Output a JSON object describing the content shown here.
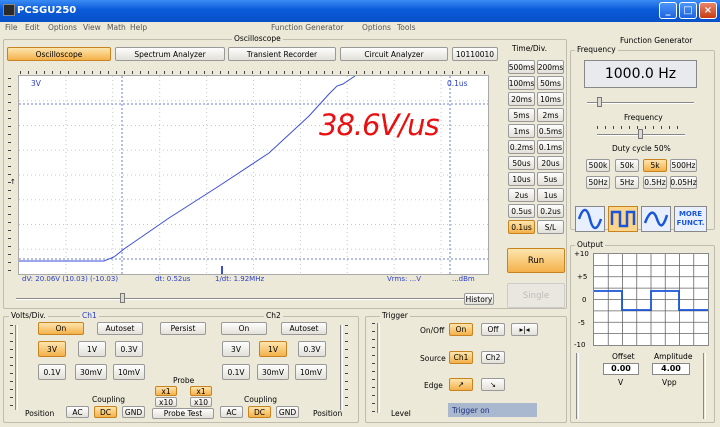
{
  "window": {
    "title": "PCSGU250",
    "minimize": "_",
    "maximize": "□",
    "close": "×"
  },
  "menu": {
    "left": [
      "File",
      "Edit",
      "Options",
      "View",
      "Math",
      "Help"
    ],
    "right_title": "Function Generator",
    "right": [
      "Options",
      "Tools"
    ]
  },
  "osc": {
    "group_label": "Oscilloscope",
    "tabs": [
      "Oscilloscope",
      "Spectrum Analyzer",
      "Transient Recorder",
      "Circuit Analyzer",
      "10110010"
    ],
    "scope": {
      "top_left": "3V",
      "top_right": "0.1us",
      "annotation": "38.6V/us",
      "readouts": {
        "dv": "dV: 20.06V  (10.03)  (-10.03)",
        "dt": "dt: 0.52us",
        "freq": "1/dt: 1.92MHz",
        "vrms": "Vrms: ...V",
        "dbm": "...dBm"
      }
    },
    "history": "History",
    "timediv": {
      "label": "Time/Div.",
      "rows": [
        [
          "500ms",
          "200ms"
        ],
        [
          "100ms",
          "50ms"
        ],
        [
          "20ms",
          "10ms"
        ],
        [
          "5ms",
          "2ms"
        ],
        [
          "1ms",
          "0.5ms"
        ],
        [
          "0.2ms",
          "0.1ms"
        ],
        [
          "50us",
          "20us"
        ],
        [
          "10us",
          "5us"
        ],
        [
          "2us",
          "1us"
        ],
        [
          "0.5us",
          "0.2us"
        ],
        [
          "0.1us",
          "S/L"
        ]
      ],
      "selected": "0.1us"
    },
    "run": "Run",
    "single": "Single"
  },
  "volts": {
    "label": "Volts/Div.",
    "ch1": "Ch1",
    "ch2": "Ch2",
    "ch1_on": "On",
    "ch1_autoset": "Autoset",
    "persist": "Persist",
    "ch2_on": "On",
    "ch2_autoset": "Autoset",
    "ch1_row1": [
      "3V",
      "1V",
      "0.3V"
    ],
    "ch1_row2": [
      "0.1V",
      "30mV",
      "10mV"
    ],
    "ch2_row1": [
      "3V",
      "1V",
      "0.3V"
    ],
    "ch2_row2": [
      "0.1V",
      "30mV",
      "10mV"
    ],
    "ch1_selected": "3V",
    "ch2_selected": "1V",
    "probe_label": "Probe",
    "probe_r1": [
      "x1",
      "x1"
    ],
    "probe_r2": [
      "x10",
      "x10"
    ],
    "probe_test": "Probe Test",
    "coupling": "Coupling",
    "coupling_opts": [
      "AC",
      "DC",
      "GND"
    ],
    "coupling_selected": "DC",
    "position": "Position"
  },
  "trigger": {
    "label": "Trigger",
    "onoff": "On/Off",
    "on": "On",
    "off": "Off",
    "source": "Source",
    "src": [
      "Ch1",
      "Ch2"
    ],
    "edge": "Edge",
    "level": "Level",
    "status": "Trigger on"
  },
  "fg": {
    "title": "Function Generator",
    "freq_label": "Frequency",
    "display": "1000.0 Hz",
    "frequency": "Frequency",
    "duty": "Duty cycle 50%",
    "freq_row1": [
      "500k",
      "50k",
      "5k",
      "500Hz"
    ],
    "freq_row2": [
      "50Hz",
      "5Hz",
      "0.5Hz",
      "0.05Hz"
    ],
    "freq_selected": "5k",
    "more": "MORE FUNCT.",
    "output": "Output",
    "y_ticks": [
      "+10",
      "+5",
      "0",
      "-5",
      "-10"
    ],
    "offset_label": "Offset",
    "offset_value": "0.00",
    "offset_unit": "V",
    "amp_label": "Amplitude",
    "amp_value": "4.00",
    "amp_unit": "Vpp"
  },
  "colors": {
    "titlebar": "#0a5ad9",
    "trace": "#3b4ed6",
    "grid": "#6a7fd8",
    "active_btn": "#f4b14a",
    "annotation": "#e81010"
  }
}
